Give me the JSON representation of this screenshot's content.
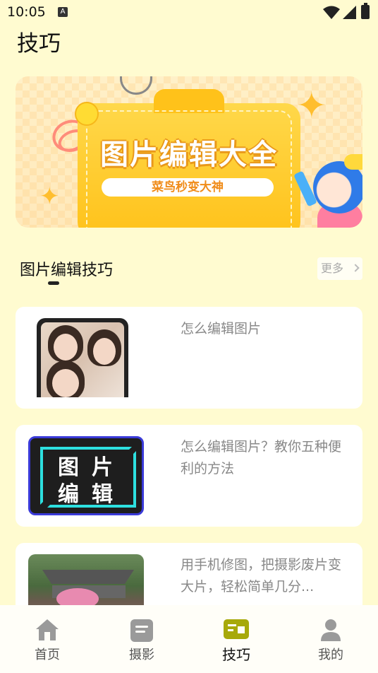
{
  "status_bar": {
    "time": "10:05",
    "a_badge": "A"
  },
  "page": {
    "title": "技巧"
  },
  "banner": {
    "title": "图片编辑大全",
    "subtitle": "菜鸟秒变大神"
  },
  "section": {
    "title": "图片编辑技巧",
    "more_label": "更多"
  },
  "articles": [
    {
      "title": "怎么编辑图片",
      "thumb": "phone-portraits"
    },
    {
      "title": "怎么编辑图片？教你五种便利的方法",
      "thumb": "text-graphic",
      "thumb_words": [
        "图片",
        "编辑"
      ]
    },
    {
      "title": "用手机修图，把摄影废片变大片，轻松简单几分...",
      "thumb": "building-photo"
    }
  ],
  "bottom_nav": {
    "items": [
      {
        "label": "首页",
        "icon": "home-icon",
        "active": false
      },
      {
        "label": "摄影",
        "icon": "note-icon",
        "active": false
      },
      {
        "label": "技巧",
        "icon": "tips-icon",
        "active": true
      },
      {
        "label": "我的",
        "icon": "profile-icon",
        "active": false
      }
    ],
    "active_color": "#a7a90a",
    "inactive_color": "#9a9a9a"
  }
}
